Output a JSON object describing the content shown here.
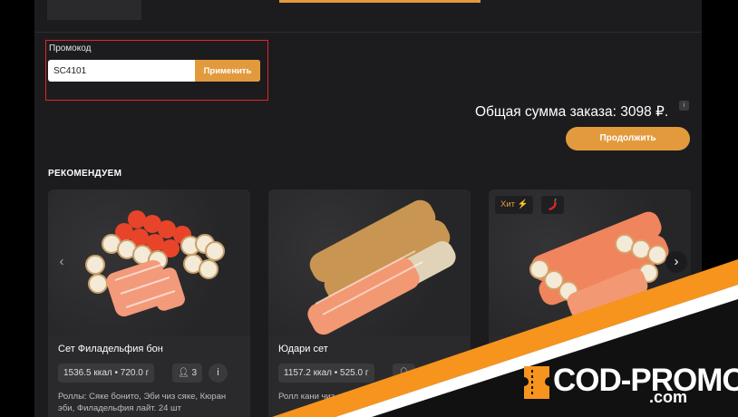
{
  "promo": {
    "label": "Промокод",
    "value": "SC4101",
    "apply_label": "Применить"
  },
  "order": {
    "total_text": "Общая сумма заказа: 3098 ₽.",
    "continue_label": "Продолжить"
  },
  "recommend": {
    "title": "РЕКОМЕНДУЕМ",
    "cards": [
      {
        "name": "Сет Филадельфия бон",
        "stats": "1536.5 ккал • 720.0 г",
        "persons": "3",
        "description": "Роллы: Сяке бонито, Эби чиз сяке, Кюран эби, Филадельфия лайт. 24 шт"
      },
      {
        "name": "Юдари сет",
        "stats": "1157.2 ккал • 525.0 г",
        "persons": "",
        "description": "Ролл кани чиз се"
      },
      {
        "name": "",
        "tag_hit": "Хит ⚡",
        "tag_spicy_icon": "chili-icon"
      }
    ]
  },
  "banner": {
    "logo_main": "COD-PROMO",
    "logo_sub": ".com",
    "colors": {
      "orange": "#f7941d",
      "white": "#ffffff"
    }
  },
  "colors": {
    "accent": "#e39a3d",
    "highlight_border": "#e0262b",
    "background": "#1c1c1e"
  }
}
